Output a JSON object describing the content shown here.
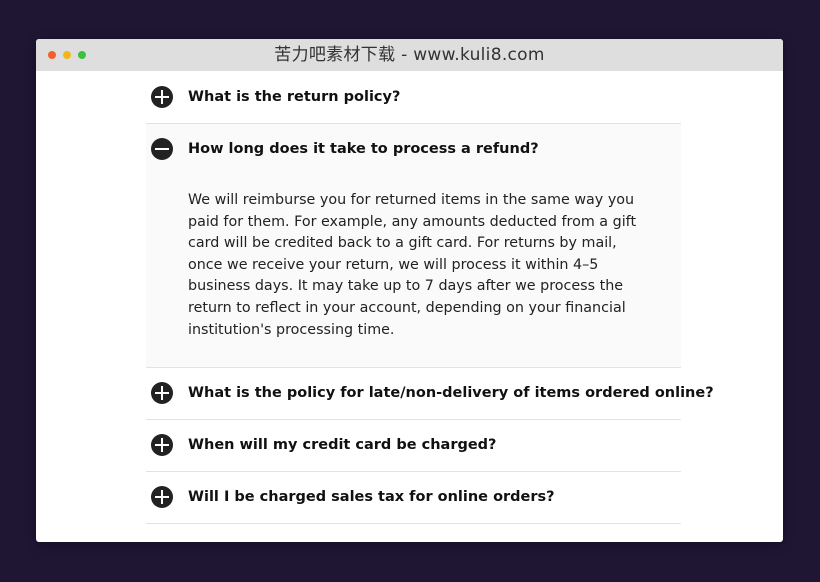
{
  "window": {
    "title": "苦力吧素材下载 - www.kuli8.com",
    "traffic_lights": {
      "close": "#f45e2a",
      "minimize": "#f2b619",
      "zoom": "#3cc23c"
    }
  },
  "faq": {
    "icon_color": "#222222",
    "items": [
      {
        "question": "What is the return policy?",
        "icon": "plus-circle-icon",
        "expanded": false
      },
      {
        "question": "How long does it take to process a refund?",
        "icon": "minus-circle-icon",
        "expanded": true,
        "answer": "We will reimburse you for returned items in the same way you paid for them. For example, any amounts deducted from a gift card will be credited back to a gift card. For returns by mail, once we receive your return, we will process it within 4–5 business days. It may take up to 7 days after we process the return to reflect in your account, depending on your financial institution's processing time."
      },
      {
        "question": "What is the policy for late/non-delivery of items ordered online?",
        "icon": "plus-circle-icon",
        "expanded": false
      },
      {
        "question": "When will my credit card be charged?",
        "icon": "plus-circle-icon",
        "expanded": false
      },
      {
        "question": "Will I be charged sales tax for online orders?",
        "icon": "plus-circle-icon",
        "expanded": false
      }
    ]
  }
}
